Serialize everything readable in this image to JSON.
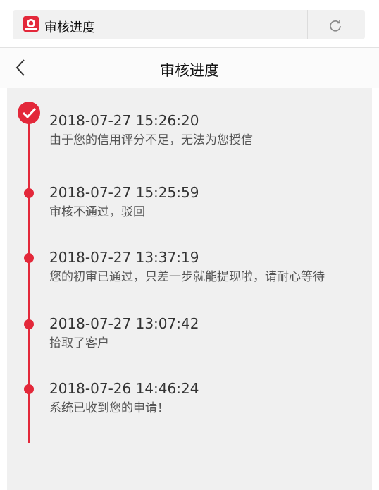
{
  "browser": {
    "tab_title": "审核进度",
    "logo_icon": "app-logo",
    "refresh_icon": "refresh-icon"
  },
  "nav": {
    "back_icon": "chevron-left-icon",
    "title": "审核进度"
  },
  "timeline": {
    "accent_color": "#e3283a",
    "items": [
      {
        "time": "2018-07-27 15:26:20",
        "desc": "由于您的信用评分不足，无法为您授信",
        "status": "current"
      },
      {
        "time": "2018-07-27 15:25:59",
        "desc": "审核不通过，驳回",
        "status": "past"
      },
      {
        "time": "2018-07-27 13:37:19",
        "desc": "您的初审已通过，只差一步就能提现啦，请耐心等待",
        "status": "past"
      },
      {
        "time": "2018-07-27 13:07:42",
        "desc": "拾取了客户",
        "status": "past"
      },
      {
        "time": "2018-07-26 14:46:24",
        "desc": "系统已收到您的申请！",
        "status": "past"
      }
    ]
  }
}
